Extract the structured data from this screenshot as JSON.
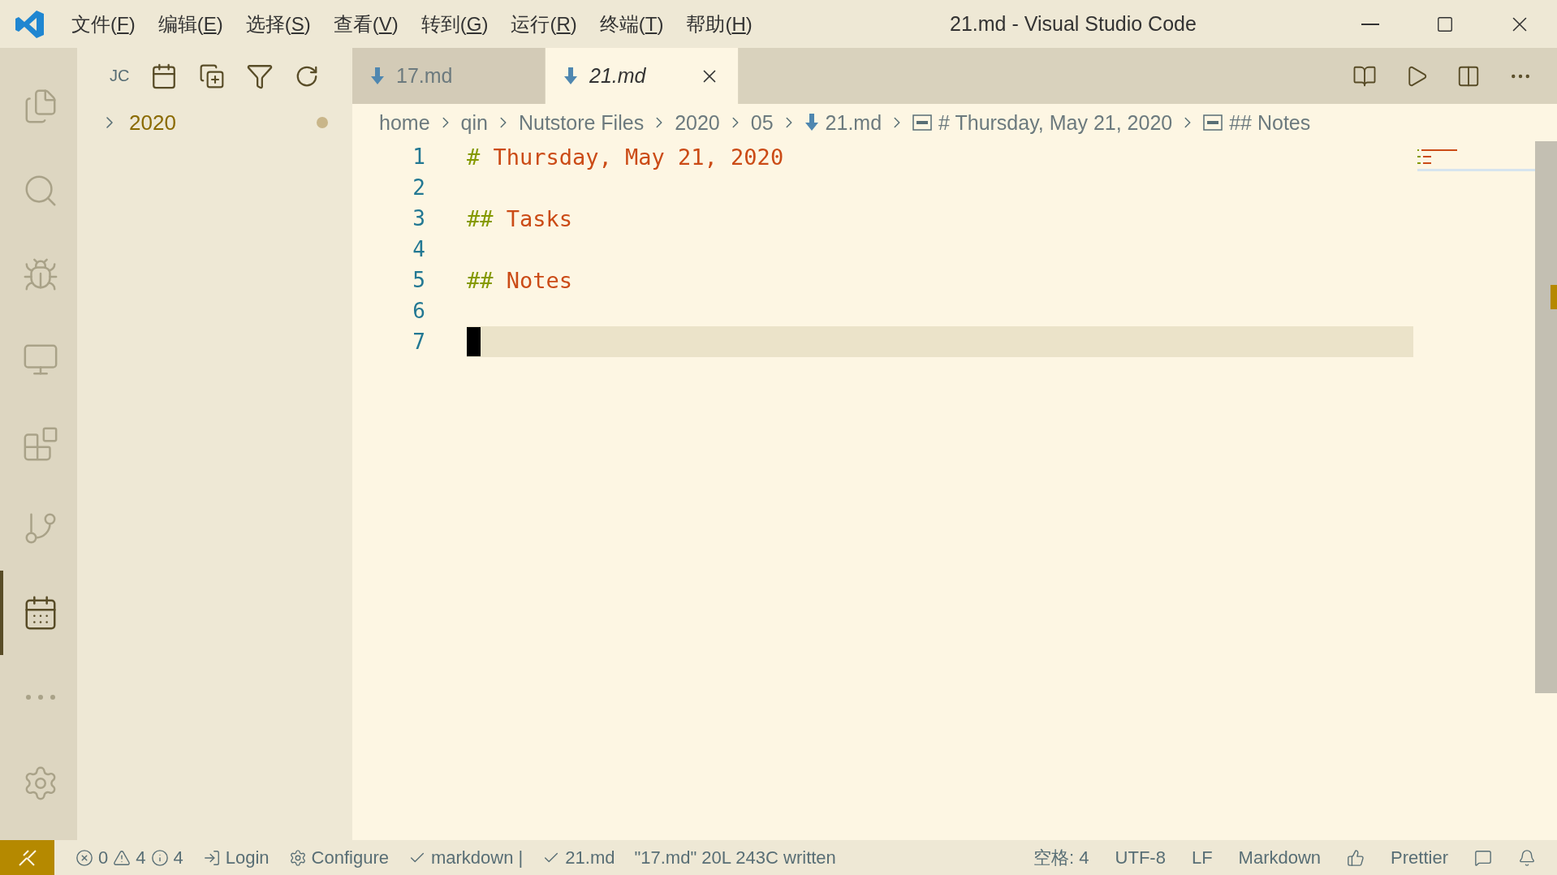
{
  "window": {
    "title": "21.md - Visual Studio Code"
  },
  "menu": [
    {
      "before": "文件(",
      "key": "F",
      "after": ")"
    },
    {
      "before": "编辑(",
      "key": "E",
      "after": ")"
    },
    {
      "before": "选择(",
      "key": "S",
      "after": ")"
    },
    {
      "before": "查看(",
      "key": "V",
      "after": ")"
    },
    {
      "before": "转到(",
      "key": "G",
      "after": ")"
    },
    {
      "before": "运行(",
      "key": "R",
      "after": ")"
    },
    {
      "before": "终端(",
      "key": "T",
      "after": ")"
    },
    {
      "before": "帮助(",
      "key": "H",
      "after": ")"
    }
  ],
  "activity_bar": [
    {
      "kind": "explorer",
      "selected": false
    },
    {
      "kind": "search",
      "selected": false
    },
    {
      "kind": "run",
      "selected": false
    },
    {
      "kind": "remote",
      "selected": false
    },
    {
      "kind": "extensions",
      "selected": false
    },
    {
      "kind": "source-control",
      "selected": false
    },
    {
      "kind": "calendar",
      "selected": true
    },
    {
      "kind": "more",
      "selected": false
    }
  ],
  "sidebar": {
    "title": "JC",
    "tree": [
      {
        "label": "2020",
        "expanded": false,
        "modified": true
      }
    ]
  },
  "tabs": [
    {
      "label": "17.md",
      "selected": false,
      "preview": false
    },
    {
      "label": "21.md",
      "selected": true,
      "preview": true
    }
  ],
  "breadcrumb": [
    {
      "kind": "folder",
      "label": "home"
    },
    {
      "kind": "folder",
      "label": "qin"
    },
    {
      "kind": "folder",
      "label": "Nutstore Files"
    },
    {
      "kind": "folder",
      "label": "2020"
    },
    {
      "kind": "folder",
      "label": "05"
    },
    {
      "kind": "file",
      "label": "21.md"
    },
    {
      "kind": "symbol",
      "label": "# Thursday, May 21, 2020"
    },
    {
      "kind": "symbol",
      "label": "## Notes"
    }
  ],
  "editor": {
    "lines": [
      {
        "number": "1",
        "marker": "#",
        "text": "Thursday, May 21, 2020",
        "current": false
      },
      {
        "number": "2",
        "current": false
      },
      {
        "number": "3",
        "marker": "##",
        "text": "Tasks",
        "current": false
      },
      {
        "number": "4",
        "current": false
      },
      {
        "number": "5",
        "marker": "##",
        "text": "Notes",
        "current": false
      },
      {
        "number": "6",
        "current": false
      },
      {
        "number": "7",
        "current": true
      }
    ]
  },
  "status_bar": {
    "errors": "0",
    "warnings": "4",
    "infos": "4",
    "left": [
      {
        "kind": "login",
        "label": "Login"
      },
      {
        "kind": "configure",
        "label": "Configure"
      },
      {
        "kind": "check",
        "label": "markdown |"
      },
      {
        "kind": "check",
        "label": "21.md"
      },
      {
        "kind": "text",
        "label": "\"17.md\" 20L 243C written"
      }
    ],
    "right": [
      {
        "kind": "text",
        "label": "空格: 4"
      },
      {
        "kind": "text",
        "label": "UTF-8"
      },
      {
        "kind": "text",
        "label": "LF"
      },
      {
        "kind": "text",
        "label": "Markdown"
      },
      {
        "kind": "thumbs"
      },
      {
        "kind": "text",
        "label": "Prettier"
      },
      {
        "kind": "feedback"
      },
      {
        "kind": "bell"
      }
    ]
  }
}
